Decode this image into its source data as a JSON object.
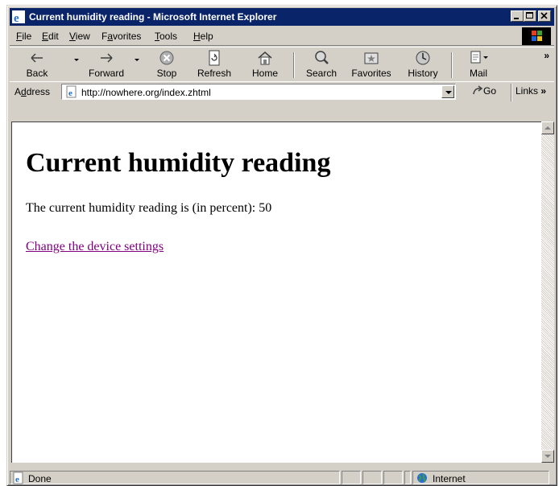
{
  "window": {
    "title": "Current humidity reading - Microsoft Internet Explorer"
  },
  "menubar": {
    "items": [
      {
        "key": "F",
        "rest": "ile"
      },
      {
        "key": "E",
        "rest": "dit"
      },
      {
        "key": "V",
        "rest": "iew"
      },
      {
        "pre": "F",
        "key": "a",
        "rest": "vorites"
      },
      {
        "key": "T",
        "rest": "ools"
      },
      {
        "key": "H",
        "rest": "elp"
      }
    ]
  },
  "toolbar": {
    "back": "Back",
    "forward": "Forward",
    "stop": "Stop",
    "refresh": "Refresh",
    "home": "Home",
    "search": "Search",
    "favorites": "Favorites",
    "history": "History",
    "mail": "Mail",
    "overflow": "»"
  },
  "address": {
    "label_pre": "A",
    "label_key": "d",
    "label_rest": "dress",
    "url": "http://nowhere.org/index.zhtml",
    "go": "Go",
    "links": "Links",
    "links_chevron": "»"
  },
  "page": {
    "heading": "Current humidity reading",
    "text": "The current humidity reading is (in percent): 50",
    "link": "Change the device settings"
  },
  "status": {
    "text": "Done",
    "zone": "Internet"
  },
  "colors": {
    "titlebar": "#0a246a",
    "chrome": "#d4d0c8",
    "visited_link": "#800080"
  }
}
